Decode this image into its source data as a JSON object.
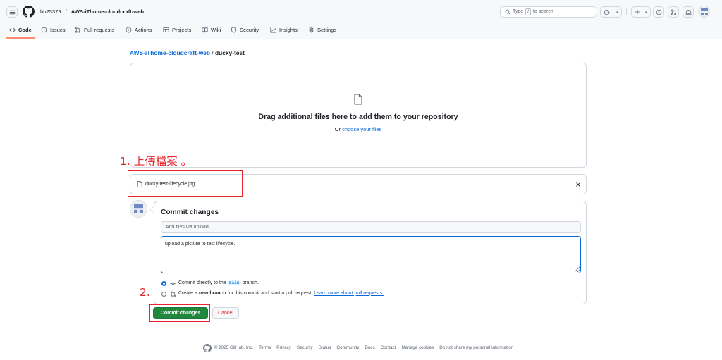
{
  "header": {
    "owner": "bb25379",
    "separator": "/",
    "repo": "AWS-iThome-cloudcraft-web",
    "search": {
      "before": "Type",
      "key": "/",
      "after": "to search"
    },
    "icons": [
      "menu-icon",
      "github-logo-icon",
      "search-icon",
      "copilot-icon",
      "plus-icon",
      "issue-opened-icon",
      "git-pull-request-icon",
      "inbox-icon",
      "avatar"
    ]
  },
  "nav": {
    "tabs": [
      {
        "label": "Code",
        "icon": "code-icon",
        "active": true
      },
      {
        "label": "Issues",
        "icon": "issue-opened-icon"
      },
      {
        "label": "Pull requests",
        "icon": "git-pull-request-icon"
      },
      {
        "label": "Actions",
        "icon": "play-icon"
      },
      {
        "label": "Projects",
        "icon": "table-icon"
      },
      {
        "label": "Wiki",
        "icon": "book-icon"
      },
      {
        "label": "Security",
        "icon": "shield-icon"
      },
      {
        "label": "Insights",
        "icon": "graph-icon"
      },
      {
        "label": "Settings",
        "icon": "gear-icon"
      }
    ]
  },
  "breadcrumb": {
    "repo": "AWS-iThome-cloudcraft-web",
    "separator": "/",
    "folder": "ducky-test"
  },
  "dropzone": {
    "title": "Drag additional files here to add them to your repository",
    "prefix": "Or",
    "link": "choose your files"
  },
  "annotations": {
    "step1": "1. 上傳檔案 。",
    "step2": "2."
  },
  "file": {
    "name": "ducky-test-lifecycle.jpg"
  },
  "commit": {
    "heading": "Commit changes",
    "summary_placeholder": "Add files via upload",
    "description": "upload a picture to test lifecycle.",
    "option_direct": {
      "before": "Commit directly to the",
      "branch": "main",
      "after": "branch.",
      "checked": true
    },
    "option_new": {
      "before": "Create a",
      "bold": "new branch",
      "after": "for this commit and start a pull request.",
      "link": "Learn more about pull requests.",
      "checked": false
    },
    "submit": "Commit changes",
    "cancel": "Cancel"
  },
  "footer": {
    "copyright": "© 2025 GitHub, Inc.",
    "links": [
      "Terms",
      "Privacy",
      "Security",
      "Status",
      "Community",
      "Docs",
      "Contact",
      "Manage cookies",
      "Do not share my personal information"
    ]
  },
  "colors": {
    "link": "#0969da",
    "primary_button": "#1f883d",
    "danger_text": "#d1242f",
    "active_tab_underline": "#fd8c73",
    "annotation": "#e3262c",
    "header_bg": "#f6f8fa"
  }
}
